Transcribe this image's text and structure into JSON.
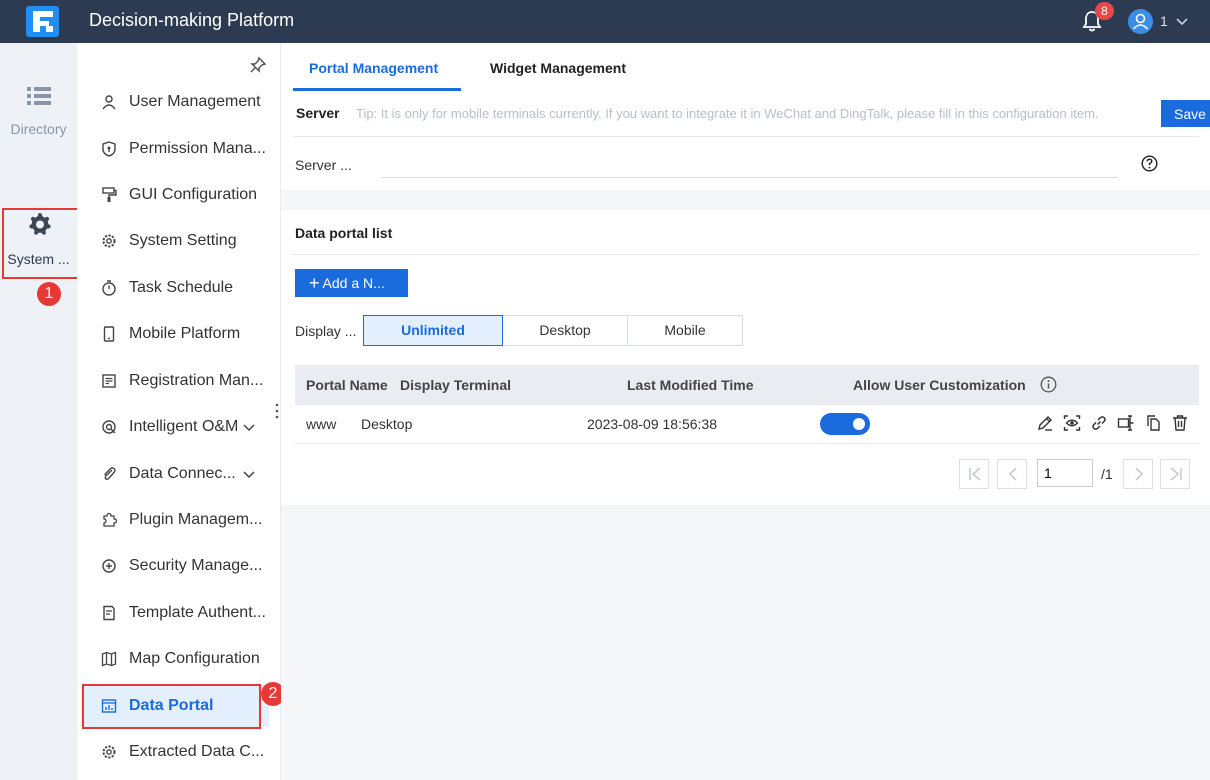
{
  "app": {
    "title": "Decision-making Platform"
  },
  "header": {
    "notification_count": "8",
    "user_name": "1"
  },
  "rail": {
    "items": [
      {
        "label": "Directory",
        "icon": "list-icon"
      },
      {
        "label": "System ...",
        "icon": "gear-icon"
      }
    ]
  },
  "annotations": {
    "step1": "1",
    "step2": "2"
  },
  "sidebar": {
    "items": [
      {
        "label": "User Management",
        "icon": "user-icon"
      },
      {
        "label": "Permission Mana...",
        "icon": "shield-icon"
      },
      {
        "label": "GUI Configuration",
        "icon": "brush-icon"
      },
      {
        "label": "System Setting",
        "icon": "gear-icon"
      },
      {
        "label": "Task Schedule",
        "icon": "stopwatch-icon"
      },
      {
        "label": "Mobile Platform",
        "icon": "mobile-icon"
      },
      {
        "label": "Registration Man...",
        "icon": "registration-icon"
      },
      {
        "label": "Intelligent O&M",
        "icon": "om-icon"
      },
      {
        "label": "Data Connec...",
        "icon": "paperclip-icon"
      },
      {
        "label": "Plugin Managem...",
        "icon": "puzzle-icon"
      },
      {
        "label": "Security Manage...",
        "icon": "security-icon"
      },
      {
        "label": "Template Authent...",
        "icon": "template-icon"
      },
      {
        "label": "Map Configuration",
        "icon": "map-icon"
      },
      {
        "label": "Data Portal",
        "icon": "portal-icon"
      },
      {
        "label": "Extracted Data C...",
        "icon": "gear-icon"
      }
    ]
  },
  "tabs": {
    "portal": "Portal Management",
    "widget": "Widget Management"
  },
  "server": {
    "title": "Server",
    "tip": "Tip: It is only for mobile terminals currently. If you want to integrate it in WeChat and DingTalk, please fill in this configuration item.",
    "save_label": "Save",
    "field_label": "Server ...",
    "field_value": ""
  },
  "portal_list": {
    "title": "Data portal list",
    "add_label": "Add a N...",
    "display_label": "Display ...",
    "filters": [
      "Unlimited",
      "Desktop",
      "Mobile"
    ],
    "selected_filter": "Unlimited",
    "columns": [
      "Portal Name",
      "Display Terminal",
      "Last Modified Time",
      "Allow User Customization"
    ],
    "rows": [
      {
        "name": "www",
        "terminal": "Desktop",
        "modified": "2023-08-09 18:56:38",
        "allow_customization": true
      }
    ],
    "row_actions": [
      "edit-icon",
      "preview-icon",
      "link-icon",
      "rename-icon",
      "copy-icon",
      "delete-icon"
    ]
  },
  "pagination": {
    "current_page": "1",
    "total": "/1"
  },
  "colors": {
    "header_bg": "#2c3a52",
    "accent": "#1a6bde",
    "highlight": "#e53935"
  }
}
